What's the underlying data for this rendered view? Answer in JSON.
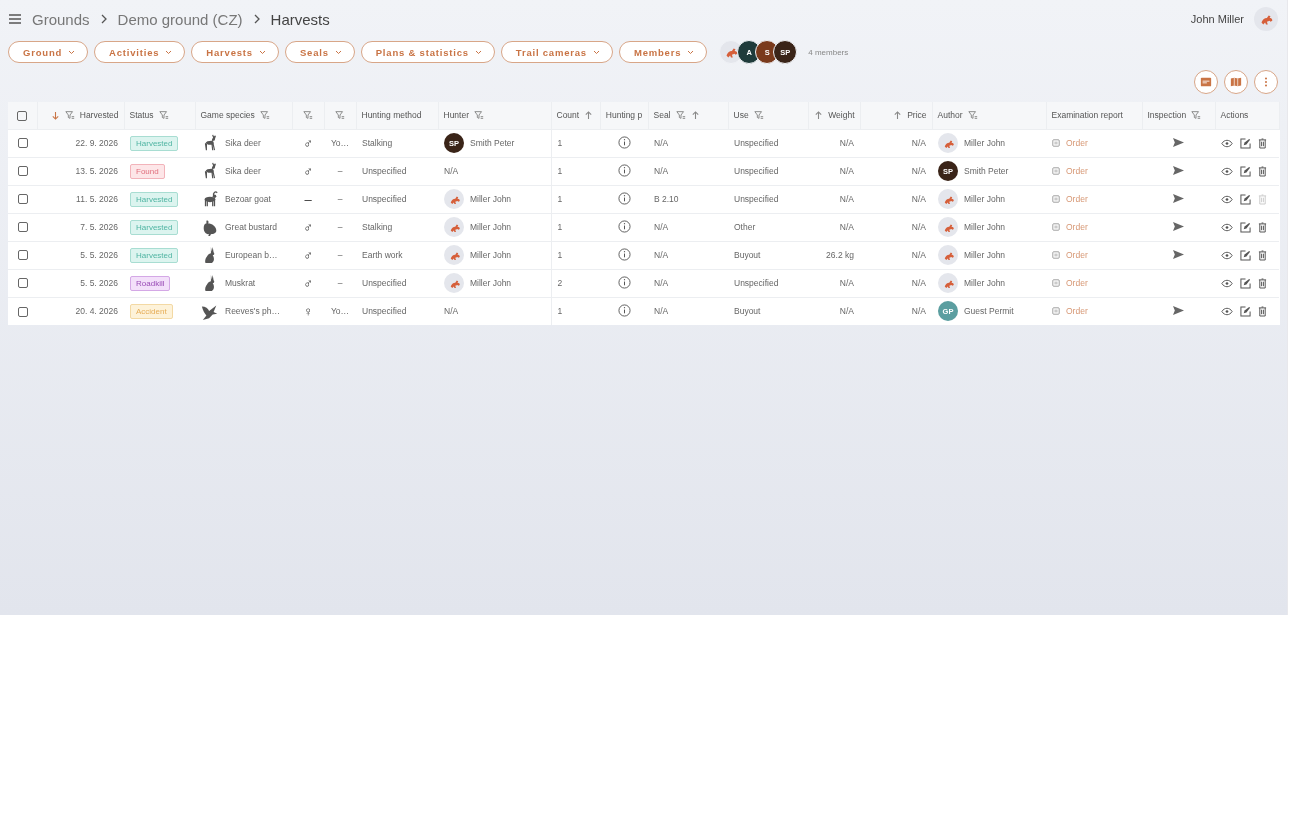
{
  "breadcrumbs": [
    {
      "label": "Grounds",
      "kind": "link"
    },
    {
      "label": "Demo ground (CZ)",
      "kind": "link"
    },
    {
      "label": "Harvests",
      "kind": "current"
    }
  ],
  "user": {
    "name": "John Miller",
    "avatar": {
      "kind": "logo"
    }
  },
  "nav": [
    "Ground",
    "Activities",
    "Harvests",
    "Seals",
    "Plans & statistics",
    "Trail cameras",
    "Members"
  ],
  "members": {
    "avatars": [
      {
        "kind": "logo"
      },
      {
        "kind": "initials",
        "initials": "A",
        "color": "#1f3b3b"
      },
      {
        "kind": "initials",
        "initials": "S",
        "color": "#7a3a1c"
      },
      {
        "kind": "initials",
        "initials": "SP",
        "color": "#3a2418"
      }
    ],
    "count_label": "4 members"
  },
  "toolbar": [
    {
      "kind": "pdf"
    },
    {
      "kind": "map"
    },
    {
      "kind": "more"
    }
  ],
  "table": {
    "all_checked": false,
    "columns": [
      {
        "parts": [
          {
            "kind": "sort_down_active"
          },
          {
            "kind": "filter"
          },
          {
            "kind": "label",
            "text": "Harvested"
          }
        ]
      },
      {
        "parts": [
          {
            "kind": "label",
            "text": "Status"
          },
          {
            "kind": "filter"
          }
        ]
      },
      {
        "parts": [
          {
            "kind": "label",
            "text": "Game species"
          },
          {
            "kind": "filter"
          }
        ]
      },
      {
        "parts": [
          {
            "kind": "filter"
          }
        ]
      },
      {
        "parts": [
          {
            "kind": "filter"
          }
        ]
      },
      {
        "parts": [
          {
            "kind": "label",
            "text": "Hunting method"
          }
        ]
      },
      {
        "parts": [
          {
            "kind": "label",
            "text": "Hunter"
          },
          {
            "kind": "filter"
          }
        ]
      },
      {
        "parts": [
          {
            "kind": "label",
            "text": "Count"
          },
          {
            "kind": "sort_up"
          }
        ]
      },
      {
        "parts": [
          {
            "kind": "label",
            "text": "Hunting p"
          }
        ]
      },
      {
        "parts": [
          {
            "kind": "label",
            "text": "Seal"
          },
          {
            "kind": "filter"
          },
          {
            "kind": "sort_up"
          }
        ]
      },
      {
        "parts": [
          {
            "kind": "label",
            "text": "Use"
          },
          {
            "kind": "filter"
          }
        ]
      },
      {
        "parts": [
          {
            "kind": "sort_up"
          },
          {
            "kind": "label",
            "text": "Weight"
          }
        ]
      },
      {
        "parts": [
          {
            "kind": "sort_up"
          },
          {
            "kind": "label",
            "text": "Price"
          }
        ]
      },
      {
        "parts": [
          {
            "kind": "label",
            "text": "Author"
          },
          {
            "kind": "filter"
          }
        ]
      },
      {
        "parts": [
          {
            "kind": "label",
            "text": "Examination report"
          }
        ]
      },
      {
        "parts": [
          {
            "kind": "label",
            "text": "Inspection"
          },
          {
            "kind": "filter"
          }
        ]
      },
      {
        "parts": [
          {
            "kind": "label",
            "text": "Actions"
          }
        ]
      }
    ],
    "rows": [
      {
        "checked": false,
        "date": "22. 9. 2026",
        "status": {
          "label": "Harvested",
          "kind": "harvested"
        },
        "species": {
          "name": "Sika deer",
          "kind": "deer"
        },
        "sex": "♂",
        "age": "Yo…",
        "method": "Stalking",
        "hunter": {
          "name": "Smith Peter",
          "avatar": {
            "kind": "initials",
            "initials": "SP",
            "color": "#3a2418"
          }
        },
        "count": "1",
        "seal": "N/A",
        "use": "Unspecified",
        "weight": "N/A",
        "price": "N/A",
        "author": {
          "name": "Miller John",
          "avatar": {
            "kind": "logo"
          }
        },
        "report": "Order",
        "inspection": true,
        "delete_disabled": false
      },
      {
        "checked": false,
        "date": "13. 5. 2026",
        "status": {
          "label": "Found",
          "kind": "found"
        },
        "species": {
          "name": "Sika deer",
          "kind": "deer"
        },
        "sex": "♂",
        "age": "–",
        "method": "Unspecified",
        "hunter": {
          "name": "N/A",
          "avatar": {
            "kind": "none"
          }
        },
        "count": "1",
        "seal": "N/A",
        "use": "Unspecified",
        "weight": "N/A",
        "price": "N/A",
        "author": {
          "name": "Smith Peter",
          "avatar": {
            "kind": "initials",
            "initials": "SP",
            "color": "#3a2418"
          }
        },
        "report": "Order",
        "inspection": true,
        "delete_disabled": false
      },
      {
        "checked": false,
        "date": "11. 5. 2026",
        "status": {
          "label": "Harvested",
          "kind": "harvested"
        },
        "species": {
          "name": "Bezoar goat",
          "kind": "goat"
        },
        "sex": "–",
        "age": "–",
        "method": "Unspecified",
        "hunter": {
          "name": "Miller John",
          "avatar": {
            "kind": "logo"
          }
        },
        "count": "1",
        "seal": "B 2.10",
        "use": "Unspecified",
        "weight": "N/A",
        "price": "N/A",
        "author": {
          "name": "Miller John",
          "avatar": {
            "kind": "logo"
          }
        },
        "report": "Order",
        "inspection": true,
        "delete_disabled": true
      },
      {
        "checked": false,
        "date": "7. 5. 2026",
        "status": {
          "label": "Harvested",
          "kind": "harvested"
        },
        "species": {
          "name": "Great bustard",
          "kind": "bustard"
        },
        "sex": "♂",
        "age": "–",
        "method": "Stalking",
        "hunter": {
          "name": "Miller John",
          "avatar": {
            "kind": "logo"
          }
        },
        "count": "1",
        "seal": "N/A",
        "use": "Other",
        "weight": "N/A",
        "price": "N/A",
        "author": {
          "name": "Miller John",
          "avatar": {
            "kind": "logo"
          }
        },
        "report": "Order",
        "inspection": true,
        "delete_disabled": false
      },
      {
        "checked": false,
        "date": "5. 5. 2026",
        "status": {
          "label": "Harvested",
          "kind": "harvested"
        },
        "species": {
          "name": "European b…",
          "kind": "hare"
        },
        "sex": "♂",
        "age": "–",
        "method": "Earth work",
        "hunter": {
          "name": "Miller John",
          "avatar": {
            "kind": "logo"
          }
        },
        "count": "1",
        "seal": "N/A",
        "use": "Buyout",
        "weight": "26.2 kg",
        "price": "N/A",
        "author": {
          "name": "Miller John",
          "avatar": {
            "kind": "logo"
          }
        },
        "report": "Order",
        "inspection": true,
        "delete_disabled": false
      },
      {
        "checked": false,
        "date": "5. 5. 2026",
        "status": {
          "label": "Roadkill",
          "kind": "roadkill"
        },
        "species": {
          "name": "Muskrat",
          "kind": "hare"
        },
        "sex": "♂",
        "age": "–",
        "method": "Unspecified",
        "hunter": {
          "name": "Miller John",
          "avatar": {
            "kind": "logo"
          }
        },
        "count": "2",
        "seal": "N/A",
        "use": "Unspecified",
        "weight": "N/A",
        "price": "N/A",
        "author": {
          "name": "Miller John",
          "avatar": {
            "kind": "logo"
          }
        },
        "report": "Order",
        "inspection": false,
        "delete_disabled": false
      },
      {
        "checked": false,
        "date": "20. 4. 2026",
        "status": {
          "label": "Accident",
          "kind": "accident"
        },
        "species": {
          "name": "Reeves's ph…",
          "kind": "flying_bird"
        },
        "sex": "♀",
        "age": "Yo…",
        "method": "Unspecified",
        "hunter": {
          "name": "N/A",
          "avatar": {
            "kind": "none"
          }
        },
        "count": "1",
        "seal": "N/A",
        "use": "Buyout",
        "weight": "N/A",
        "price": "N/A",
        "author": {
          "name": "Guest Permit",
          "avatar": {
            "kind": "initials",
            "initials": "GP",
            "color": "#5b9ea0"
          }
        },
        "report": "Order",
        "inspection": true,
        "delete_disabled": false
      }
    ]
  }
}
